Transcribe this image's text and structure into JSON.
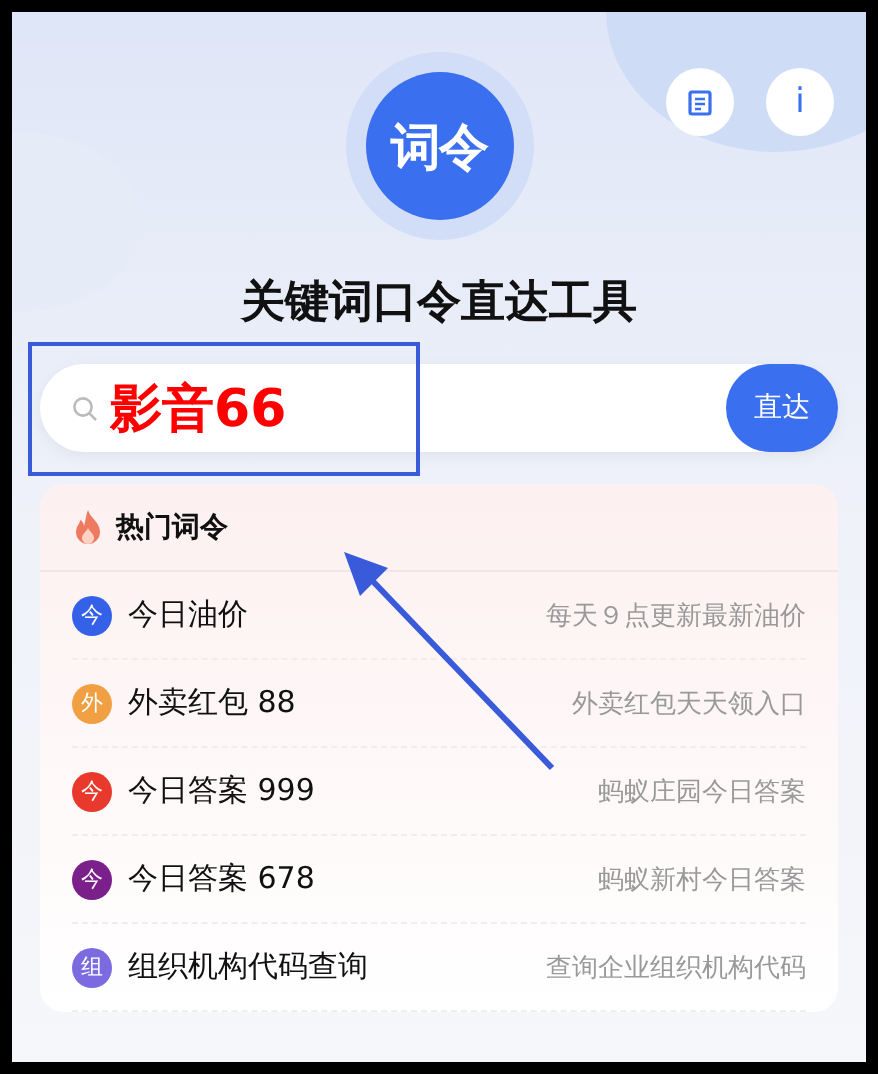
{
  "logo": {
    "text": "词令"
  },
  "header_buttons": [
    {
      "kind": "doc"
    },
    {
      "kind": "info",
      "label": "i"
    }
  ],
  "title": "关键词口令直达工具",
  "search": {
    "value": "影音66",
    "button": "直达"
  },
  "hot": {
    "heading": "热门词令",
    "items": [
      {
        "badge": "今",
        "color": "#3461e8",
        "name": "今日油价",
        "desc": "每天９点更新最新油价"
      },
      {
        "badge": "外",
        "color": "#f0a043",
        "name": "外卖红包 88",
        "desc": "外卖红包天天领入口"
      },
      {
        "badge": "今",
        "color": "#e8392c",
        "name": "今日答案 999",
        "desc": "蚂蚁庄园今日答案"
      },
      {
        "badge": "今",
        "color": "#7b1f8a",
        "name": "今日答案 678",
        "desc": "蚂蚁新村今日答案"
      },
      {
        "badge": "组",
        "color": "#7b6ae0",
        "name": "组织机构代码查询",
        "desc": "查询企业组织机构代码"
      }
    ]
  }
}
